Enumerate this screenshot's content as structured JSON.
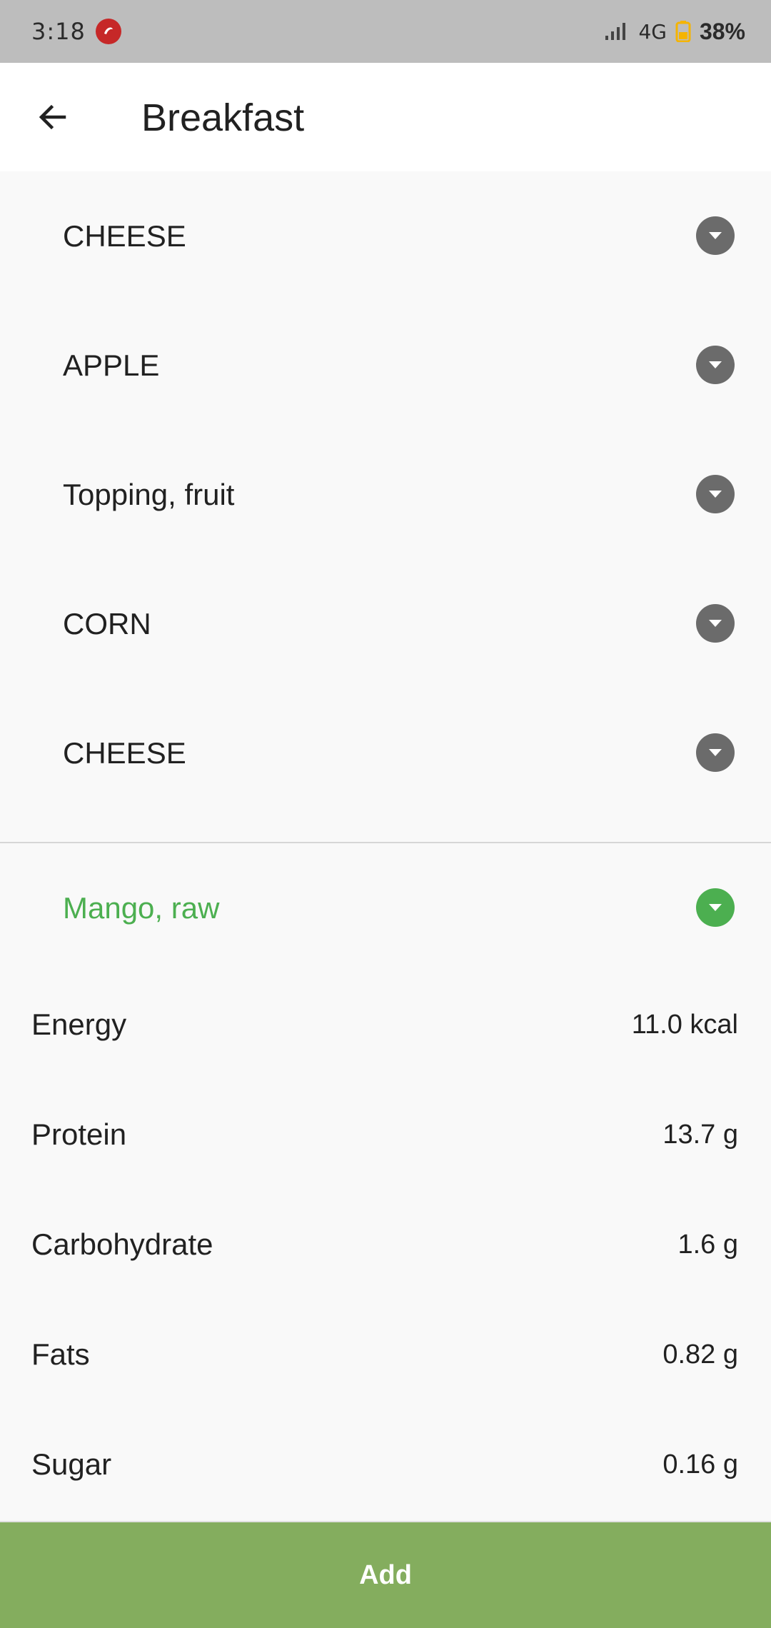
{
  "status_bar": {
    "time": "3:18",
    "network": "4G",
    "battery": "38%"
  },
  "app_bar": {
    "title": "Breakfast"
  },
  "food_items": [
    {
      "label": "CHEESE"
    },
    {
      "label": "APPLE"
    },
    {
      "label": "Topping, fruit"
    },
    {
      "label": "CORN"
    },
    {
      "label": "CHEESE"
    }
  ],
  "expanded_item": {
    "label": "Mango, raw",
    "accent_color": "#4caf50"
  },
  "nutrients": [
    {
      "name": "Energy",
      "value": "11.0 kcal"
    },
    {
      "name": "Protein",
      "value": "13.7 g"
    },
    {
      "name": "Carbohydrate",
      "value": "1.6 g"
    },
    {
      "name": "Fats",
      "value": "0.82 g"
    },
    {
      "name": "Sugar",
      "value": "0.16 g"
    }
  ],
  "add_button": {
    "label": "Add",
    "color": "#84ad5e"
  }
}
